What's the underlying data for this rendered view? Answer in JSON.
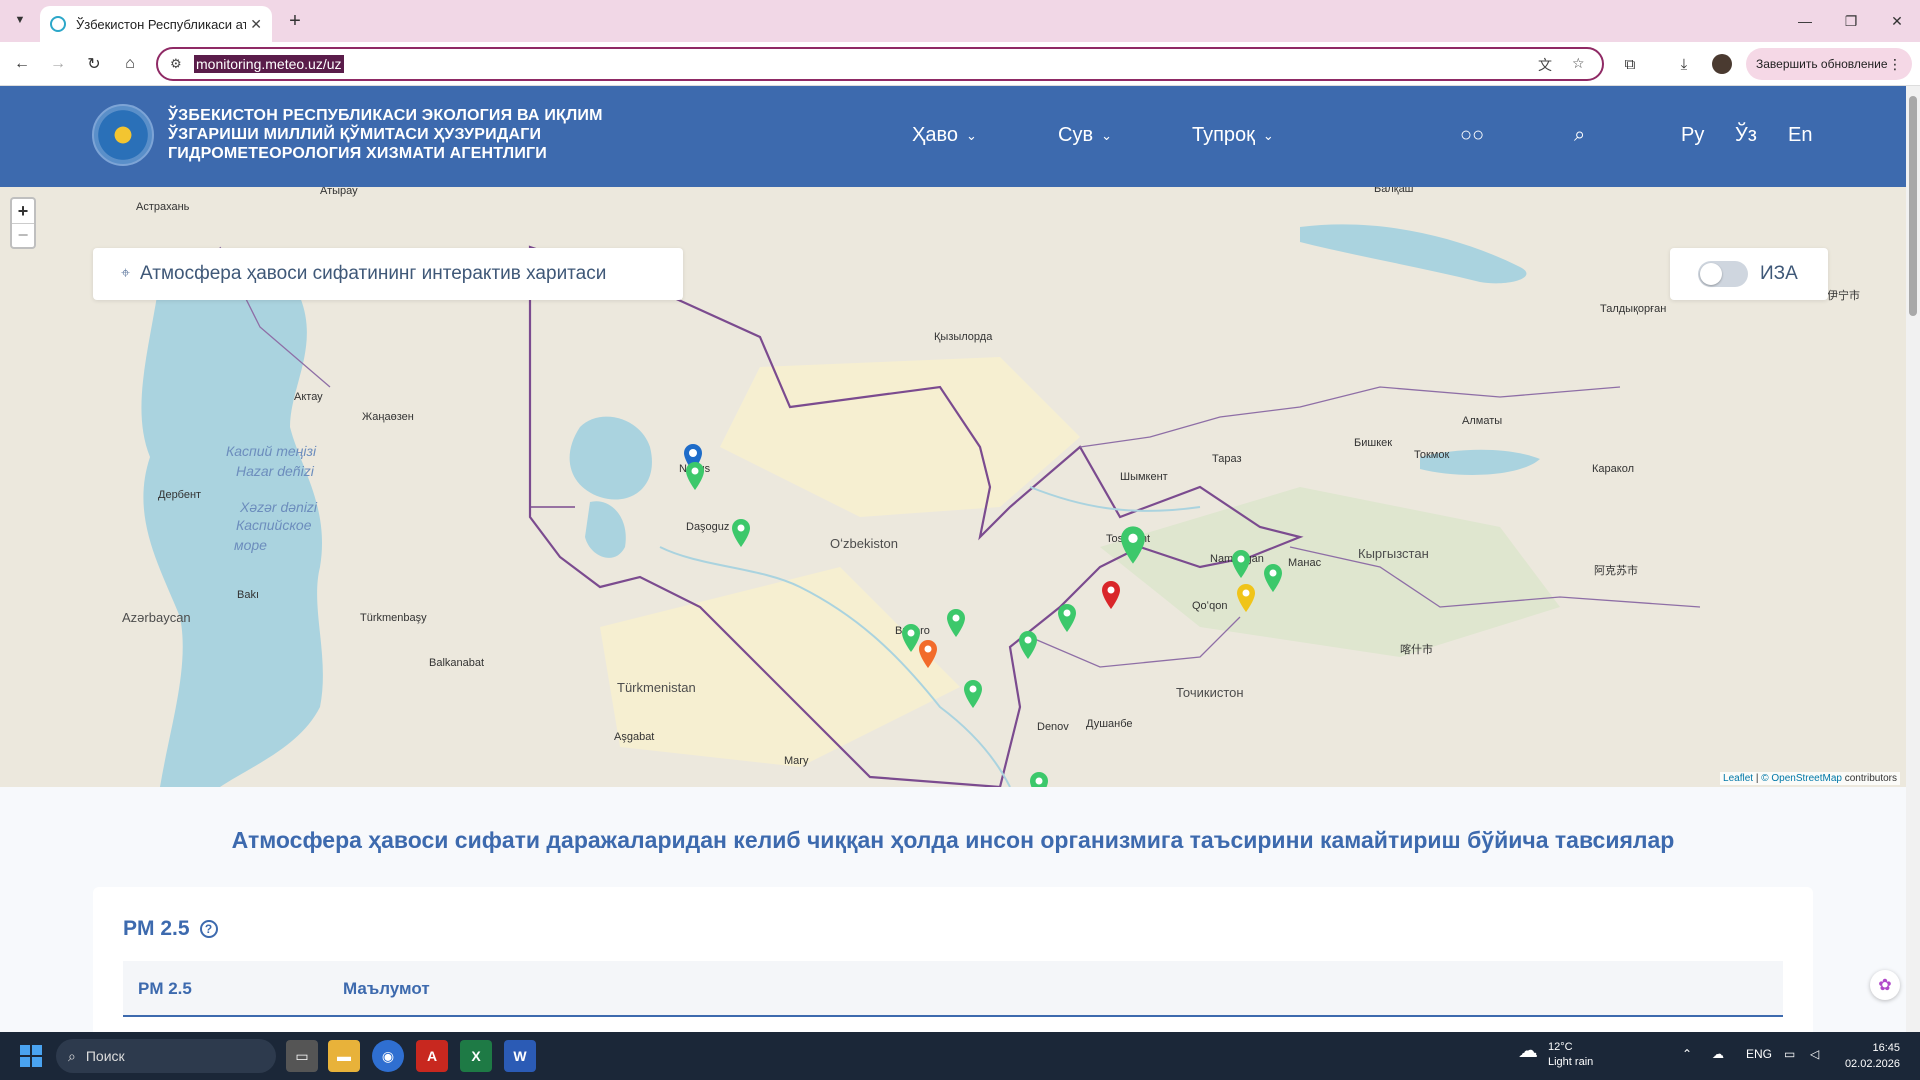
{
  "browser": {
    "tab_title": "Ўзбекистон Республикаси атр",
    "url": "monitoring.meteo.uz/uz",
    "update_label": "Завершить обновление"
  },
  "header": {
    "org_line1": "ЎЗБЕКИСТОН РЕСПУБЛИКАСИ ЭКОЛОГИЯ ВА ИҚЛИМ",
    "org_line2": "ЎЗГАРИШИ МИЛЛИЙ ҚЎМИТАСИ ҲУЗУРИДАГИ",
    "org_line3": "ГИДРОМЕТЕОРОЛОГИЯ ХИЗМАТИ АГЕНТЛИГИ",
    "nav": [
      "Ҳаво",
      "Сув",
      "Тупроқ"
    ],
    "langs": [
      "Ру",
      "Ўз",
      "En"
    ]
  },
  "map": {
    "title": "Атмосфера ҳавоси сифатининг интерактив харитаси",
    "toggle_label": "ИЗА",
    "zoom_in": "+",
    "zoom_out": "−",
    "attribution_leaflet": "Leaflet",
    "attribution_osm": "© OpenStreetMap",
    "attribution_rest": " contributors",
    "labels": {
      "atyrau": "Атырау",
      "astrakhan": "Астрахань",
      "aktau": "Актау",
      "zhanaozen": "Жаңаөзен",
      "derbent": "Дербент",
      "baku": "Bakı",
      "azerbaijan": "Azərbaycan",
      "turkmenbashi": "Türkmenbaşy",
      "balkanabat": "Balkanabat",
      "ashgabat": "Aşgabat",
      "turkmenistan": "Türkmenistan",
      "dashoguz": "Daşoguz",
      "nukus": "Nukus",
      "uzbekistan": "Oʻzbekiston",
      "bukhara": "Buxoro",
      "kyzylorda": "Қызылорда",
      "shymkent": "Шымкент",
      "taraz": "Тараз",
      "bishkek": "Бишкек",
      "tokmok": "Токмок",
      "almaty": "Алматы",
      "taldykorgan": "Талдықорған",
      "karakol": "Каракол",
      "kyrgyzstan": "Кыргызстан",
      "tajikistan": "Точикистон",
      "dushanbe": "Душанбе",
      "denov": "Denov",
      "mary": "Mary",
      "balkhash": "Балқаш",
      "kokand": "Qoʻqon",
      "namangan": "Namangan",
      "manas": "Манас",
      "caspian1": "Каспий теңізі",
      "caspian2": "Hazar deñizi",
      "caspian3": "Xəzər dənizi",
      "caspian4": "Каспийское",
      "caspian5": "море",
      "kashgar": "喀什市",
      "aksu": "阿克苏市",
      "yining": "伊宁市",
      "tokhar": "Toshkent"
    },
    "marker_colors": {
      "good": "#3cc86b",
      "moderate": "#f0c419",
      "unhealthy": "#f26b2b",
      "bad": "#d9262a",
      "info": "#1e6cc9"
    }
  },
  "content": {
    "recommendation_title": "Атмосфера ҳавоси сифати даражаларидан келиб чиққан ҳолда инсон организмига таъсирини камайтириш бўйича тавсиялар",
    "pm_title": "PM 2.5",
    "help_icon": "?",
    "table_col1": "PM 2.5",
    "table_col2": "Маълумот"
  },
  "taskbar": {
    "search_placeholder": "Поиск",
    "weather_temp": "12°C",
    "weather_desc": "Light rain",
    "lang": "ENG",
    "time": "16:45",
    "date": "02.02.2026"
  }
}
